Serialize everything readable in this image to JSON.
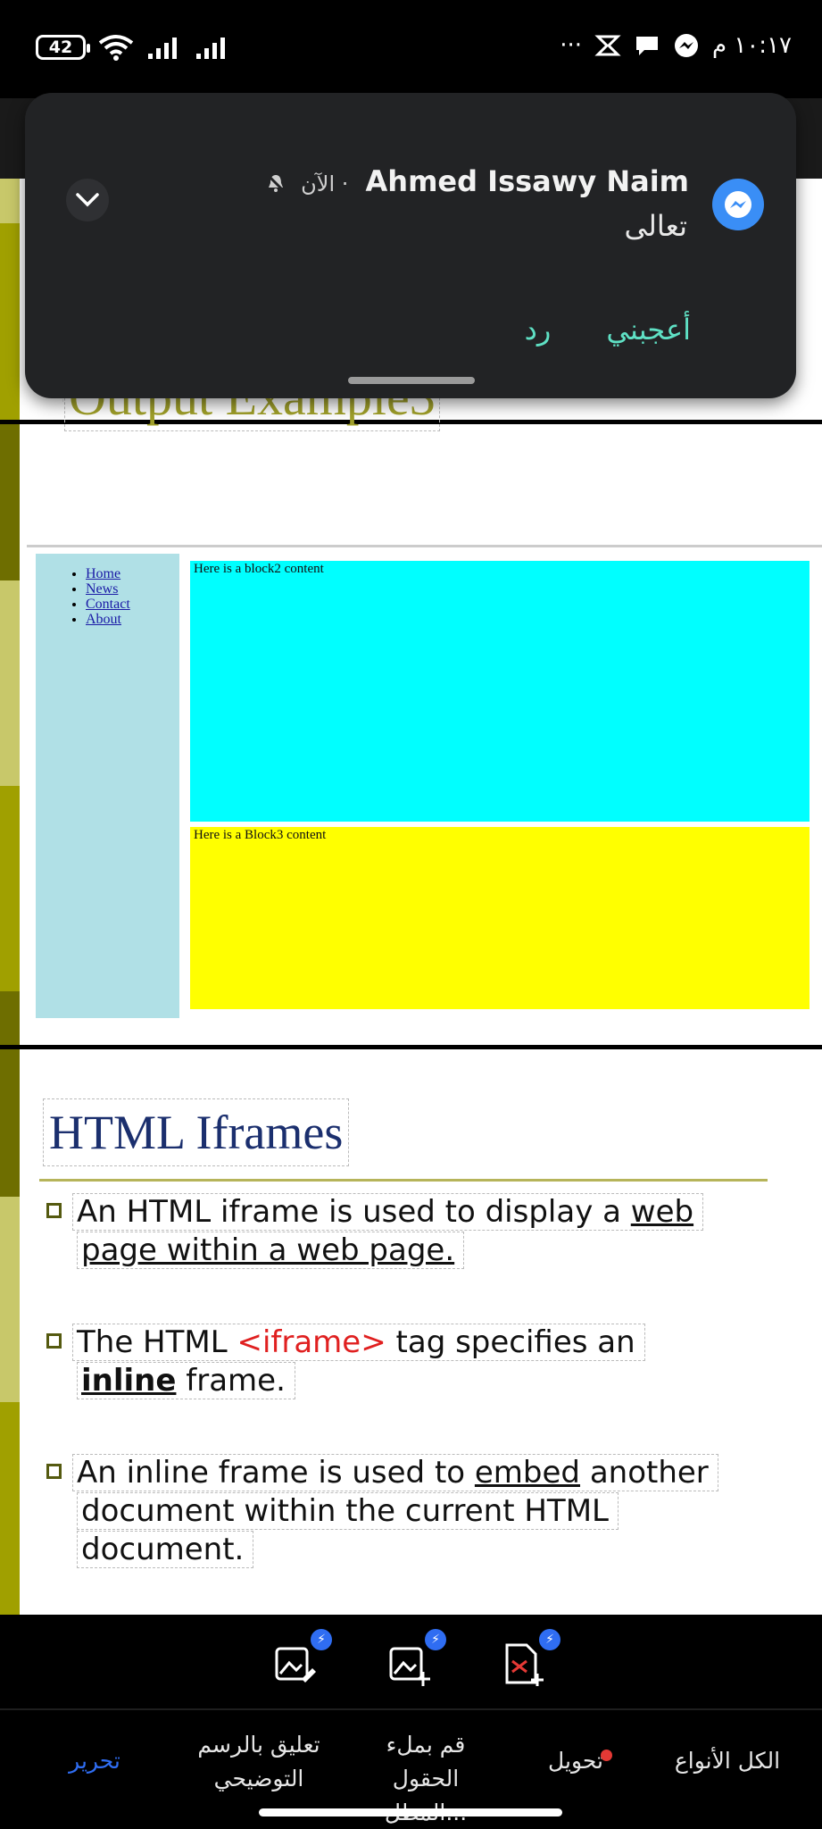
{
  "status_bar": {
    "battery": "42",
    "time": "١٠:١٧ م",
    "more": "···",
    "icons": [
      "wifi-icon",
      "signal-icon",
      "signal-icon",
      "messenger-icon",
      "chat-icon",
      "app-icon"
    ]
  },
  "slide_output": {
    "title": "Output Example3",
    "nav_links": [
      "Home",
      "News",
      "Contact",
      "About"
    ],
    "block2_text": "Here is a block2 content",
    "block3_text": "Here is a Block3 content",
    "colors": {
      "sidebar": "#b0e0e6",
      "block2": "#00ffff",
      "block3": "#ffff00",
      "title": "#a0a02a"
    }
  },
  "slide_iframes": {
    "title": "HTML Iframes",
    "bullet1": {
      "a": "An HTML iframe is used to display a ",
      "u": "web",
      "b": "page within a web page."
    },
    "bullet2": {
      "a": "The HTML ",
      "tag": "<iframe>",
      "c": " tag specifies an",
      "strong": "inline",
      "d": " frame."
    },
    "bullet3": {
      "a": "An inline frame is used to ",
      "u": "embed",
      "b": " another",
      "c": "document within the current HTML",
      "d": "document."
    }
  },
  "notification": {
    "sender": "Ahmed Issawy Naim",
    "time": "الآن ·",
    "message": "تعالى",
    "actions": {
      "like": "أعجبني",
      "reply": "رد"
    },
    "app_icon": "messenger-icon"
  },
  "toolbar": {
    "tools": [
      "edit-image-icon",
      "add-image-icon",
      "pdf-add-icon"
    ]
  },
  "bottom_nav": {
    "all_types": "الكل الأنواع",
    "convert": "تحويل",
    "fill_line1": "قم بملء",
    "fill_line2": "الحقول المطل...",
    "annotate_line1": "تعليق بالرسم",
    "annotate_line2": "التوضيحي",
    "edit": "تحرير"
  }
}
